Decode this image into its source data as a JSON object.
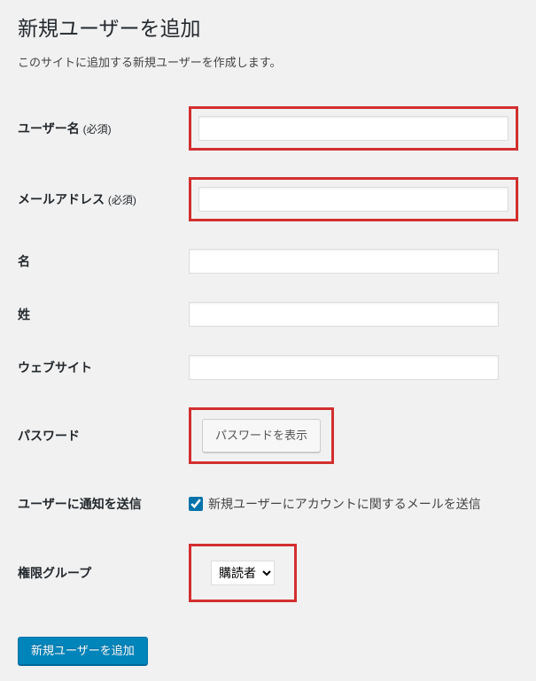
{
  "page_title": "新規ユーザーを追加",
  "description": "このサイトに追加する新規ユーザーを作成します。",
  "required_suffix": "(必須)",
  "labels": {
    "username": "ユーザー名",
    "email": "メールアドレス",
    "first_name": "名",
    "last_name": "姓",
    "website": "ウェブサイト",
    "password": "パスワード",
    "notify": "ユーザーに通知を送信",
    "role": "権限グループ"
  },
  "fields": {
    "username": "",
    "email": "",
    "first_name": "",
    "last_name": "",
    "website": ""
  },
  "password_button": "パスワードを表示",
  "notify_checkbox": {
    "checked": true,
    "label": "新規ユーザーにアカウントに関するメールを送信"
  },
  "role_select": {
    "selected": "購読者"
  },
  "submit_button": "新規ユーザーを追加"
}
